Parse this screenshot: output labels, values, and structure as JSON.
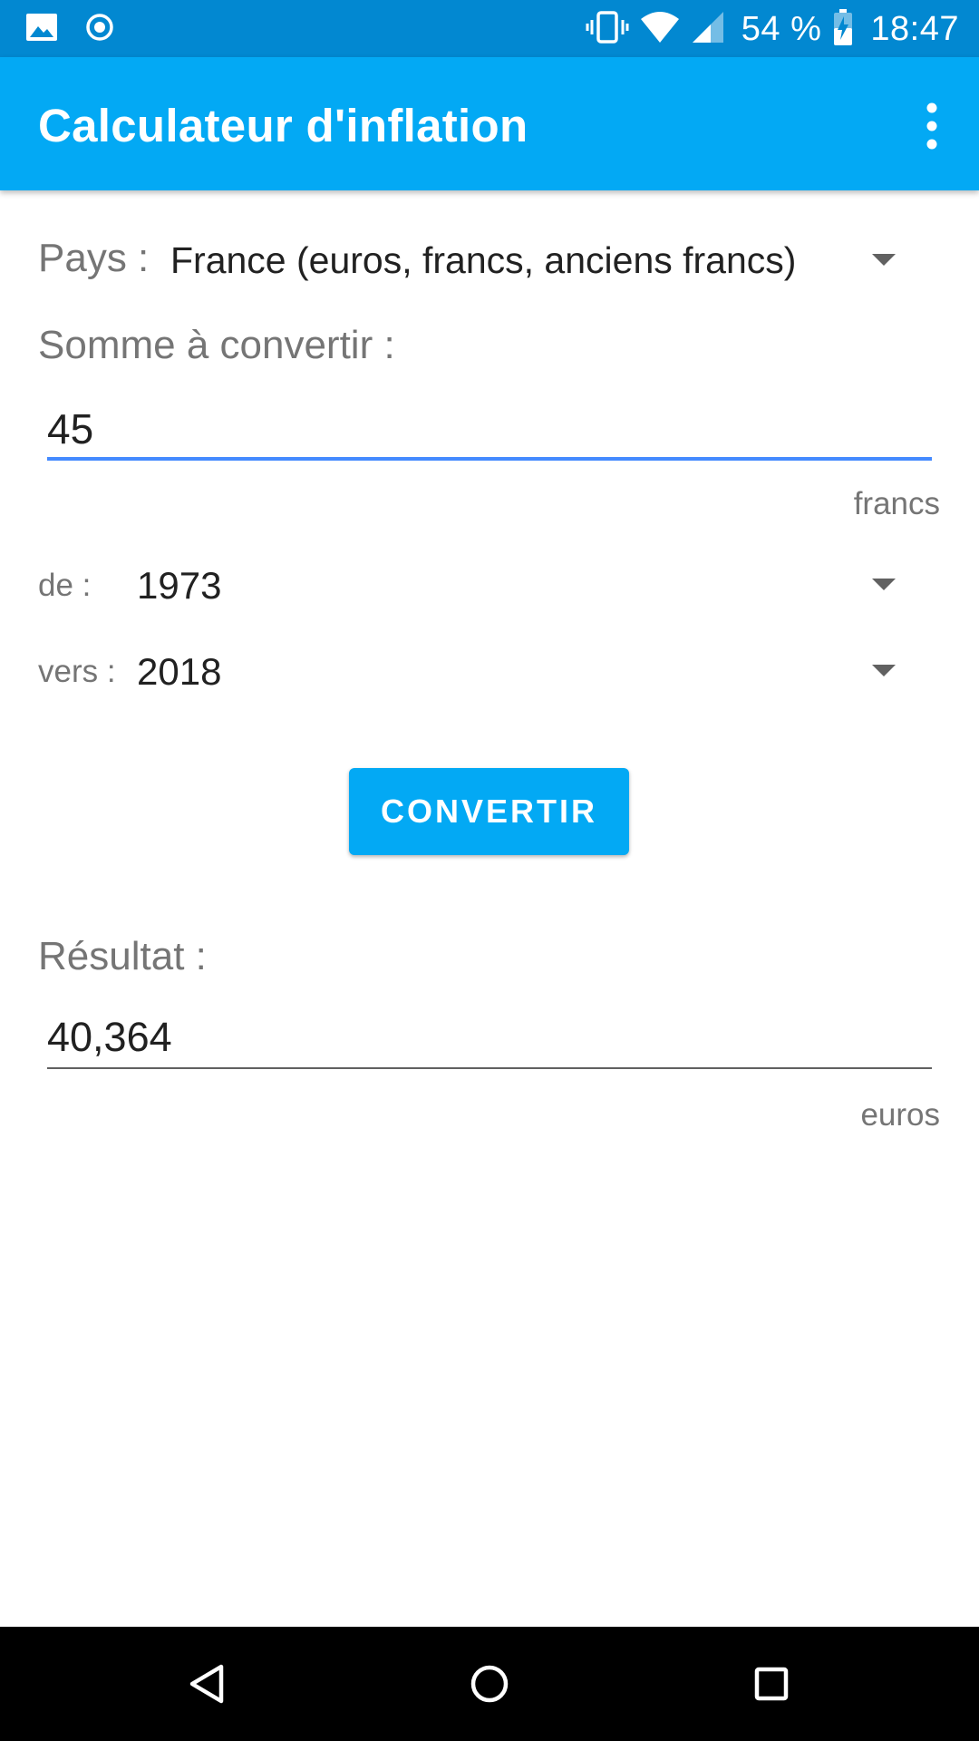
{
  "status_bar": {
    "battery": "54 %",
    "time": "18:47"
  },
  "app_bar": {
    "title": "Calculateur d'inflation"
  },
  "form": {
    "country_label": "Pays :",
    "country_value": "France (euros, francs, anciens francs)",
    "amount_label": "Somme à convertir :",
    "amount_value": "45",
    "amount_unit": "francs",
    "from_label": "de :",
    "from_year": "1973",
    "to_label": "vers :",
    "to_year": "2018",
    "convert_button": "CONVERTIR",
    "result_label": "Résultat :",
    "result_value": "40,364",
    "result_unit": "euros"
  },
  "colors": {
    "status_bar": "#0288d1",
    "app_bar": "#03a9f4",
    "accent": "#448aff"
  },
  "icons": {
    "status_left": [
      "image-icon",
      "record-icon"
    ],
    "status_right": [
      "vibrate-icon",
      "wifi-icon",
      "signal-icon",
      "battery-charging-icon"
    ],
    "nav": [
      "back-icon",
      "home-icon",
      "recents-icon"
    ]
  }
}
